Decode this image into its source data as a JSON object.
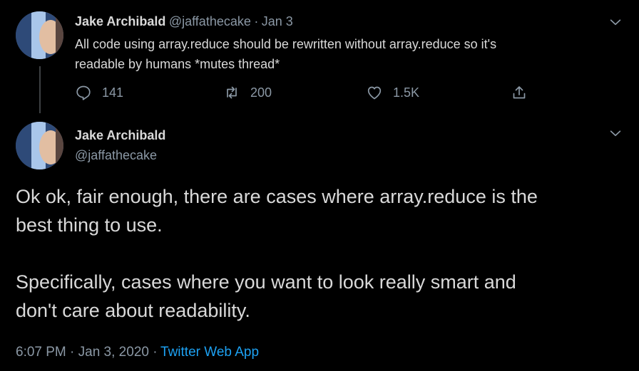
{
  "parent_tweet": {
    "author_name": "Jake Archibald",
    "author_handle": "@jaffathecake",
    "separator": "·",
    "date": "Jan 3",
    "text_line1": "All code using array.reduce should be rewritten without array.reduce so it's",
    "text_line2": "readable by humans *mutes thread*",
    "actions": {
      "reply_count": "141",
      "retweet_count": "200",
      "like_count": "1.5K"
    }
  },
  "main_tweet": {
    "author_name": "Jake Archibald",
    "author_handle": "@jaffathecake",
    "lines": [
      "Ok ok, fair enough, there are cases where array.reduce is the",
      "best thing to use.",
      "Specifically, cases where you want to look really smart and",
      "don't care about readability."
    ],
    "timestamp": "6:07 PM · Jan 3, 2020 ·",
    "source": "Twitter Web App"
  },
  "colors": {
    "background": "#000000",
    "text": "#d9d9d9",
    "secondary": "#8b98a5",
    "link": "#1da1f2"
  },
  "icons": {
    "reply": "reply-icon",
    "retweet": "retweet-icon",
    "like": "heart-icon",
    "share": "share-icon",
    "more": "chevron-down-icon"
  }
}
